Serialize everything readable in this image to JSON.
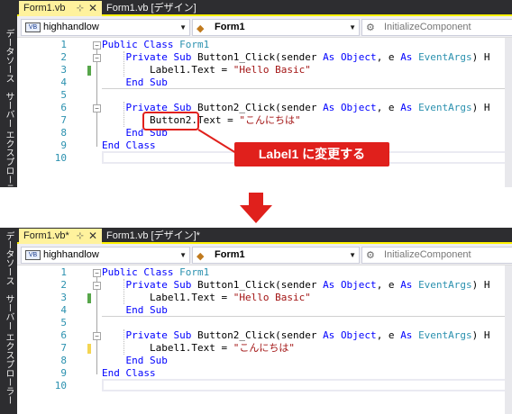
{
  "colors": {
    "callout": "#e0201c",
    "arrow": "#e0201c",
    "tab_active": "#fff29d",
    "changed_marker_saved": "#57a64a",
    "changed_marker_unsaved": "#f4d552",
    "keyword": "#0000ff",
    "type": "#2b91af",
    "string": "#a31515"
  },
  "side_panel": {
    "text": "データソース　サーバー エクスプローラー"
  },
  "before": {
    "tabs": [
      {
        "label": "Form1.vb",
        "pin": "⊹",
        "close": "✕"
      },
      {
        "label": "Form1.vb [デザイン]"
      }
    ],
    "nav": {
      "scope": "highhandlow",
      "class": "Form1",
      "member": "InitializeComponent"
    }
  },
  "after": {
    "tabs": [
      {
        "label": "Form1.vb*",
        "pin": "⊹",
        "close": "✕"
      },
      {
        "label": "Form1.vb [デザイン]*"
      }
    ],
    "nav": {
      "scope": "highhandlow",
      "class": "Form1",
      "member": "InitializeComponent"
    }
  },
  "line_numbers": [
    "1",
    "2",
    "3",
    "4",
    "5",
    "6",
    "7",
    "8",
    "9",
    "10"
  ],
  "code_tokens": {
    "public": "Public",
    "class_kw": "Class",
    "form1": "Form1",
    "private": "Private",
    "sub": "Sub",
    "btn1": "Button1_Click",
    "btn2": "Button2_Click",
    "params_a": "(sender ",
    "as": "As",
    "object": "Object",
    "params_b": ", e ",
    "eventargs": "EventArgs",
    "params_c": ") H",
    "label1": "Label1",
    "button2": "Button2",
    "text_assign": ".Text = ",
    "str_hello": "\"Hello Basic\"",
    "str_konnichiwa": "\"こんにちは\"",
    "end": "End"
  },
  "callout": {
    "label": "Label1 に変更する"
  }
}
